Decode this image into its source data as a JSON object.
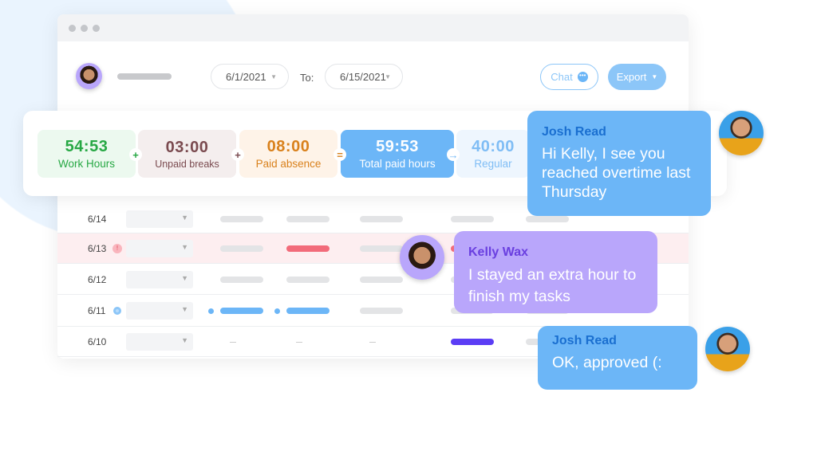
{
  "header": {
    "date_from": "6/1/2021",
    "to_label": "To:",
    "date_to": "6/15/2021",
    "chat_label": "Chat",
    "export_label": "Export"
  },
  "summary": [
    {
      "value": "54:53",
      "label": "Work Hours",
      "op": "+"
    },
    {
      "value": "03:00",
      "label": "Unpaid breaks",
      "op": "+"
    },
    {
      "value": "08:00",
      "label": "Paid absence",
      "op": "="
    },
    {
      "value": "59:53",
      "label": "Total paid hours",
      "op": "→"
    },
    {
      "value": "40:00",
      "label": "Regular"
    }
  ],
  "rows": [
    {
      "date": "6/14"
    },
    {
      "date": "6/13",
      "flag": "!"
    },
    {
      "date": "6/12"
    },
    {
      "date": "6/11"
    },
    {
      "date": "6/10"
    }
  ],
  "messages": [
    {
      "name": "Josh Read",
      "text": "Hi Kelly, I see you reached overtime last Thursday"
    },
    {
      "name": "Kelly Wax",
      "text": "I stayed an extra hour to finish my tasks"
    },
    {
      "name": "Josh Read",
      "text": "OK, approved (:"
    }
  ],
  "colors": {
    "accent": "#6cb6f7",
    "kelly": "#b9a6fb",
    "alert": "#f26b7a",
    "overtime": "#5b3df5"
  }
}
